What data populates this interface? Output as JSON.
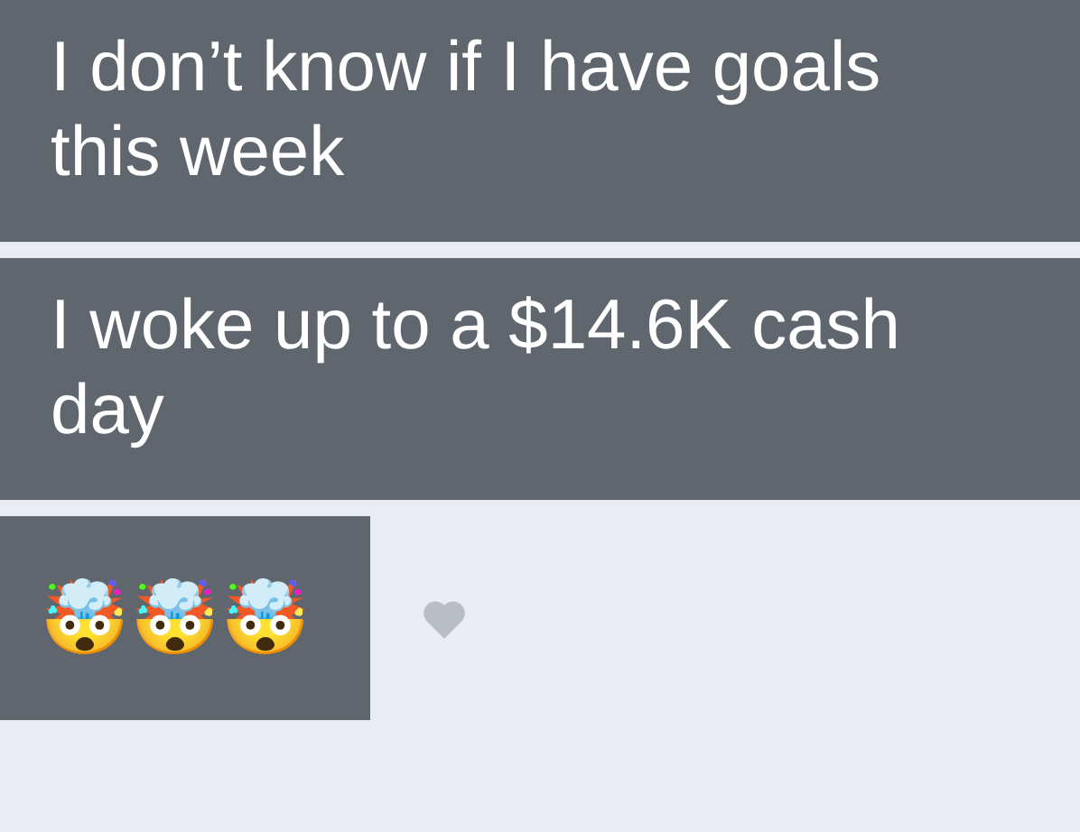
{
  "messages": [
    {
      "kind": "text",
      "text": "I don’t know if I have goals this week"
    },
    {
      "kind": "text",
      "text": "I woke up to a $14.6K cash day"
    },
    {
      "kind": "emoji",
      "text": "🤯🤯🤯",
      "liked": false
    }
  ]
}
